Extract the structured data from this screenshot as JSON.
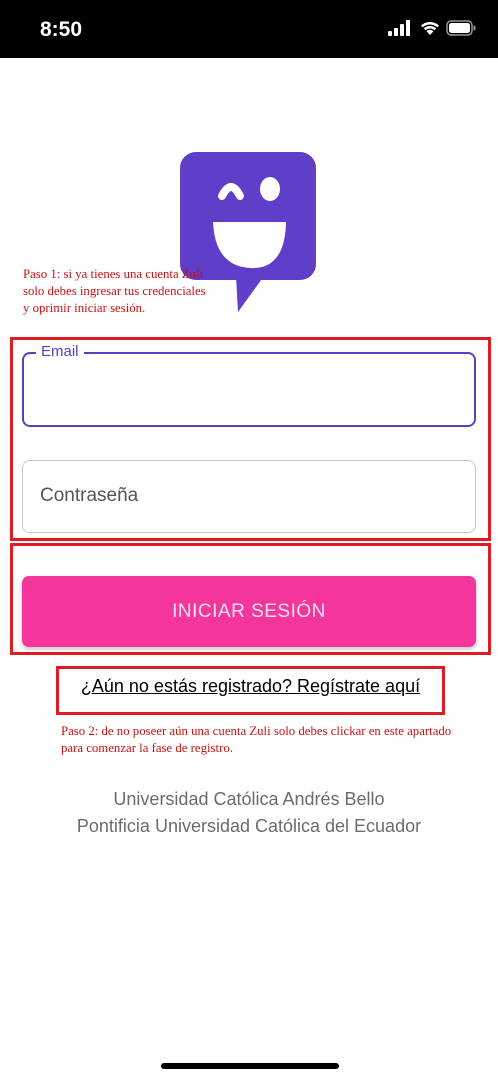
{
  "status_bar": {
    "time": "8:50",
    "icons": [
      "signal-icon",
      "wifi-icon",
      "battery-icon"
    ]
  },
  "logo": {
    "icon": "smiley-chat-bubble-icon",
    "color": "#5f3ec9"
  },
  "annotations": {
    "step1": "Paso 1: si ya tienes una cuenta Zuli solo debes ingresar tus credenciales y oprimir iniciar sesión.",
    "step2": "Paso 2: de no poseer aún una cuenta Zuli solo debes clickar en este apartado para comenzar la fase de registro."
  },
  "form": {
    "email_label": "Email",
    "email_value": "",
    "password_placeholder": "Contraseña",
    "password_value": "",
    "login_button": "INICIAR SESIÓN"
  },
  "register_link": "¿Aún no estás registrado? Regístrate aquí",
  "footer": {
    "line1": "Universidad Católica Andrés Bello",
    "line2": "Pontificia Universidad Católica del Ecuador"
  },
  "colors": {
    "accent": "#5a3fc0",
    "button": "#f4359c",
    "annotation": "#e01b24"
  }
}
